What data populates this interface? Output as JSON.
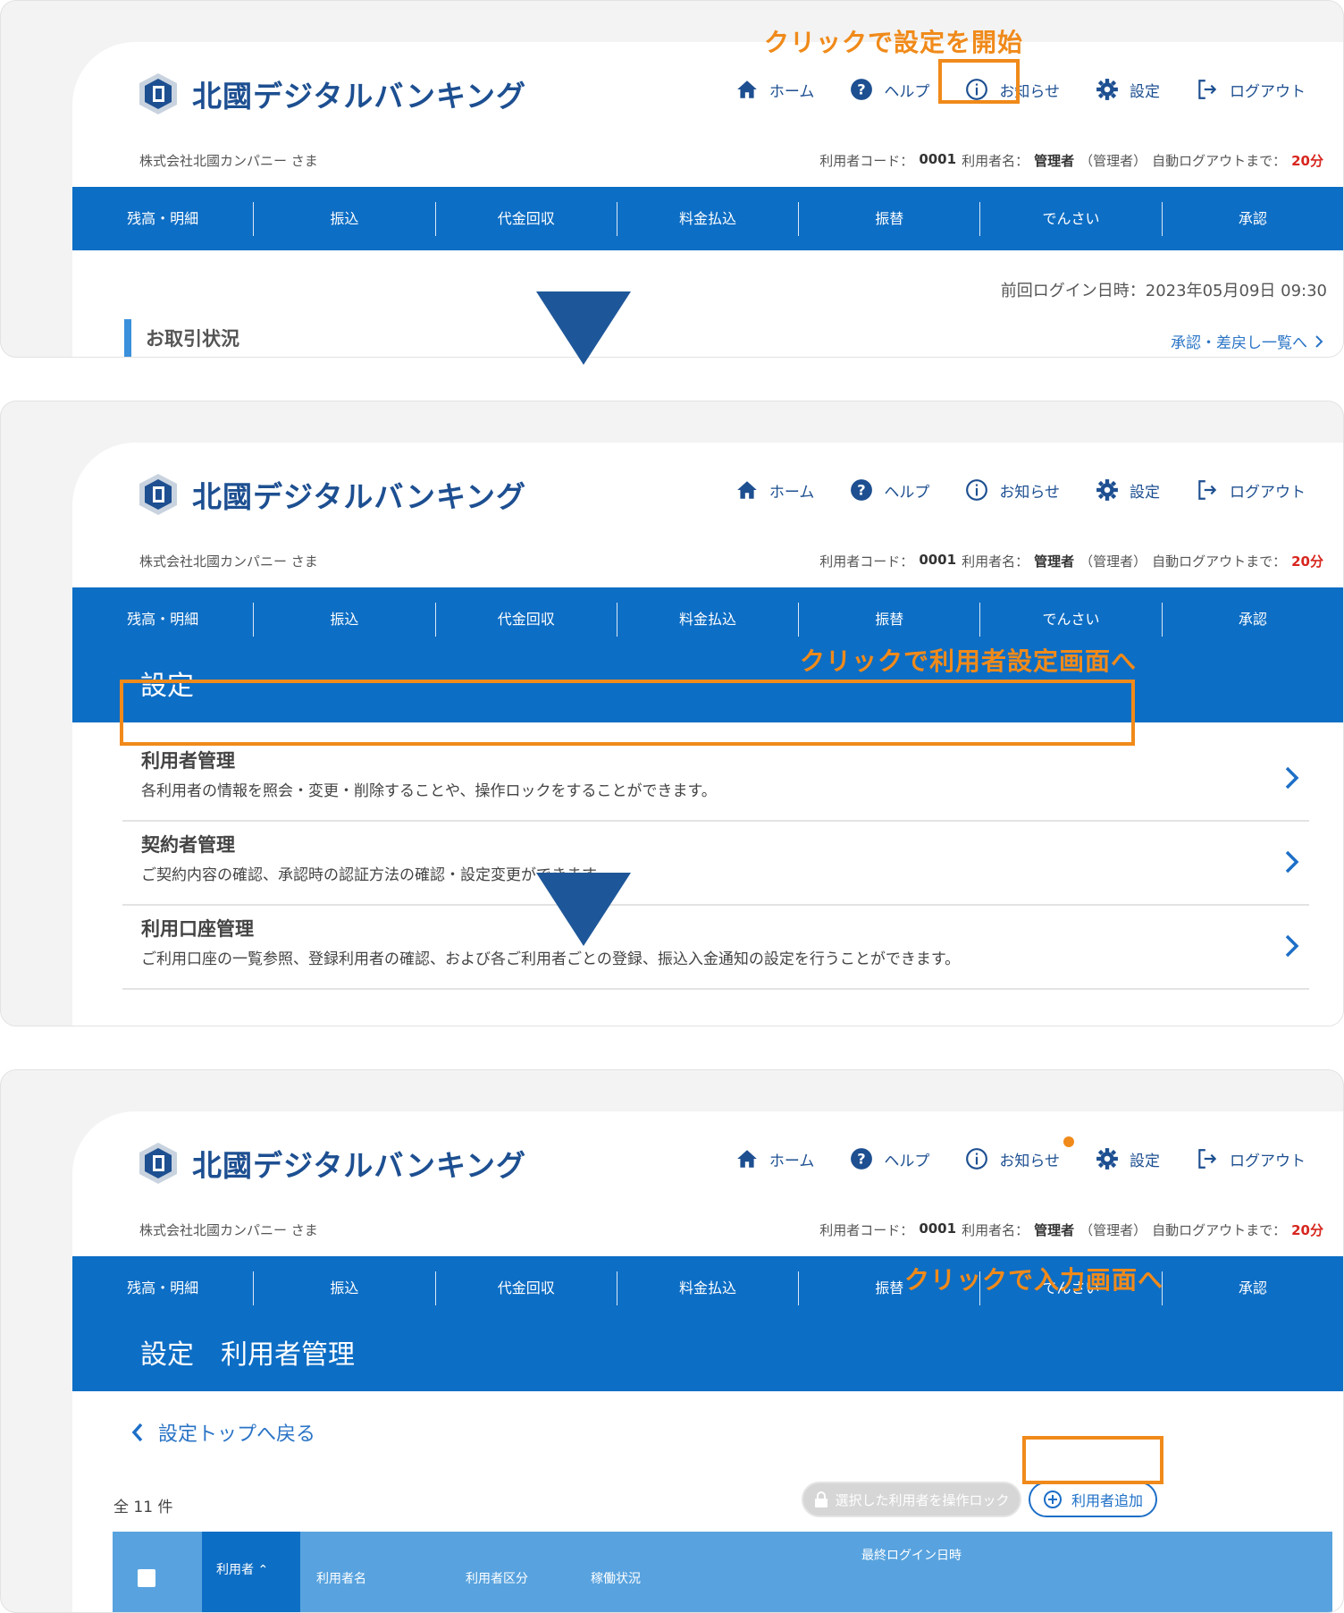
{
  "brand": {
    "name": "北國デジタルバンキング",
    "accent": "#0d6ec5",
    "highlight": "#f08a1a",
    "arrow_color": "#1e5799"
  },
  "header": {
    "nav": [
      {
        "label": "ホーム",
        "icon": "home-icon"
      },
      {
        "label": "ヘルプ",
        "icon": "help-icon"
      },
      {
        "label": "お知らせ",
        "icon": "info-icon"
      },
      {
        "label": "設定",
        "icon": "gear-icon"
      },
      {
        "label": "ログアウト",
        "icon": "logout-icon"
      }
    ],
    "company": "株式会社北國カンパニー さま",
    "user_code_label": "利用者コード：",
    "user_code": "0001",
    "user_name_label": "利用者名：",
    "user_name": "管理者",
    "user_role": "（管理者）",
    "auto_logout_label": "自動ログアウトまで：",
    "auto_logout_time": "20分"
  },
  "menu": [
    "残高・明細",
    "振込",
    "代金回収",
    "料金払込",
    "振替",
    "でんさい",
    "承認"
  ],
  "step1": {
    "callout": "クリックで設定を開始",
    "last_login": "前回ログイン日時：2023年05月09日 09:30",
    "section_title": "お取引状況",
    "approval_link": "承認・差戻し一覧へ"
  },
  "step2": {
    "page_title": "設定",
    "callout": "クリックで利用者設定画面へ",
    "items": [
      {
        "title": "利用者管理",
        "desc": "各利用者の情報を照会・変更・削除することや、操作ロックをすることができます。"
      },
      {
        "title": "契約者管理",
        "desc": "ご契約内容の確認、承認時の認証方法の確認・設定変更ができます。"
      },
      {
        "title": "利用口座管理",
        "desc": "ご利用口座の一覧参照、登録利用者の確認、および各ご利用者ごとの登録、振込入金通知の設定を行うことができます。"
      }
    ]
  },
  "step3": {
    "page_title": "設定　利用者管理",
    "back_link": "設定トップへ戻る",
    "callout": "クリックで入力画面へ",
    "count": "全 11 件",
    "lock_button": "選択した利用者を操作ロック",
    "add_button": "利用者追加",
    "table_headers": {
      "user": "利用者",
      "user_name": "利用者名",
      "user_type": "利用者区分",
      "status": "稼働状況",
      "last_login": "最終ログイン日時"
    }
  }
}
